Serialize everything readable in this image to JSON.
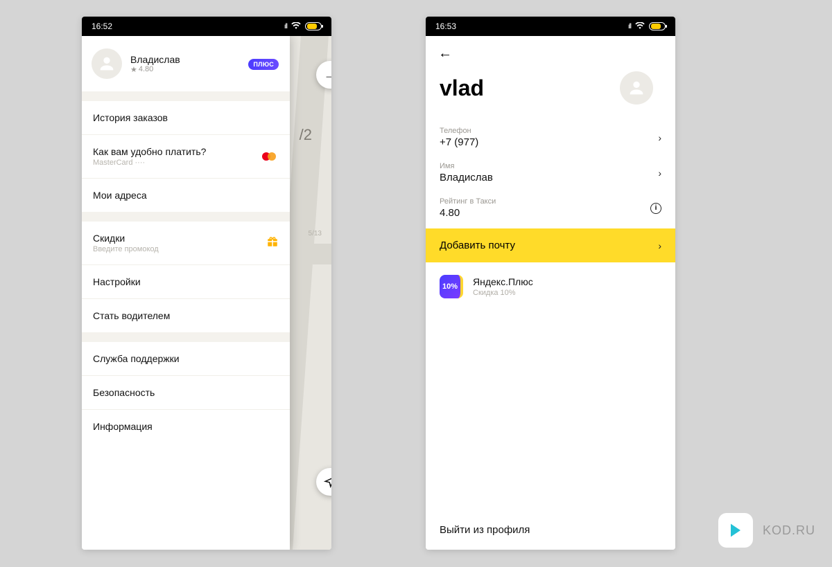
{
  "status_bar": {
    "time_left": "16:52",
    "time_right": "16:53",
    "battery": "63"
  },
  "drawer": {
    "profile": {
      "name": "Владислав",
      "rating": "4.80",
      "plus_badge": "ПЛЮС"
    },
    "items": {
      "history": "История заказов",
      "payment_title": "Как вам удобно платить?",
      "payment_sub": "MasterCard ····",
      "addresses": "Мои адреса",
      "discounts_title": "Скидки",
      "discounts_sub": "Введите промокод",
      "settings": "Настройки",
      "driver": "Стать водителем",
      "support": "Служба поддержки",
      "security": "Безопасность",
      "info": "Информация"
    }
  },
  "profile_page": {
    "title": "vlad",
    "phone_label": "Телефон",
    "phone_value": "+7 (977)",
    "name_label": "Имя",
    "name_value": "Владислав",
    "rating_label": "Рейтинг в Такси",
    "rating_value": "4.80",
    "add_email": "Добавить почту",
    "plus_title": "Яндекс.Плюс",
    "plus_sub": "Скидка 10%",
    "plus_badge": "10%",
    "logout": "Выйти из профиля"
  },
  "watermark": "KOD.RU"
}
